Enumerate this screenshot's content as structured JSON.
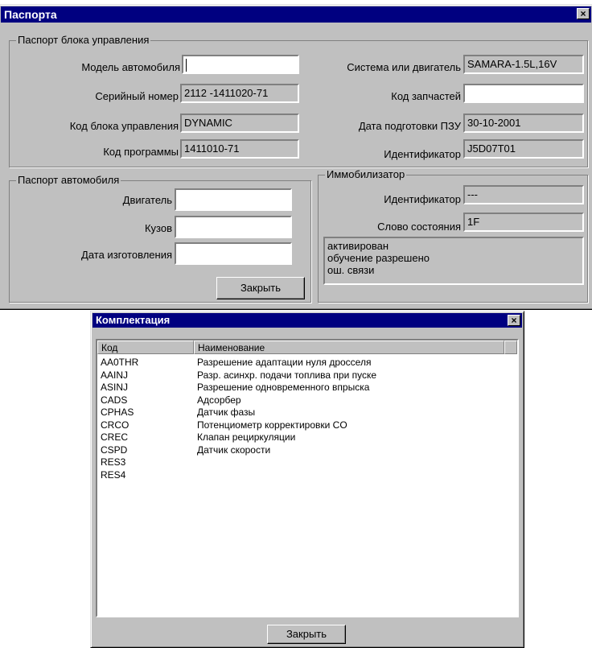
{
  "passport": {
    "title": "Паспорта",
    "close_icon": "×",
    "ecu_group": {
      "title": "Паспорт блока управления",
      "model_label": "Модель автомобиля",
      "model_value": "",
      "serial_label": "Серийный номер",
      "serial_value": "2112 -1411020-71",
      "ecu_code_label": "Код блока управления",
      "ecu_code_value": "DYNAMIC",
      "program_label": "Код программы",
      "program_value": "1411010-71",
      "engine_system_label": "Система или двигатель",
      "engine_system_value": "SAMARA-1.5L,16V",
      "parts_code_label": "Код запчастей",
      "parts_code_value": "",
      "rom_date_label": "Дата подготовки ПЗУ",
      "rom_date_value": "30-10-2001",
      "identifier_label": "Идентификатор",
      "identifier_value": "J5D07T01"
    },
    "car_group": {
      "title": "Паспорт автомобиля",
      "engine_label": "Двигатель",
      "engine_value": "",
      "body_label": "Кузов",
      "body_value": "",
      "mfg_date_label": "Дата изготовления",
      "mfg_date_value": ""
    },
    "immo_group": {
      "title": "Иммобилизатор",
      "identifier_label": "Идентификатор",
      "identifier_value": "---",
      "status_word_label": "Слово состояния",
      "status_word_value": "1F",
      "status_lines": [
        "активирован",
        "обучение разрешено",
        "ош. связи"
      ]
    },
    "close_button": "Закрыть"
  },
  "equipment": {
    "title": "Комплектация",
    "close_icon": "×",
    "columns": [
      "Код",
      "Наименование"
    ],
    "rows": [
      {
        "code": "AA0THR",
        "name": "Разрешение адаптации нуля дросселя"
      },
      {
        "code": "AAINJ",
        "name": "Разр. асинхр. подачи топлива при пуске"
      },
      {
        "code": "ASINJ",
        "name": "Разрешение одновременного впрыска"
      },
      {
        "code": "CADS",
        "name": "Адсорбер"
      },
      {
        "code": "CPHAS",
        "name": "Датчик фазы"
      },
      {
        "code": "CRCO",
        "name": "Потенциометр корректировки CO"
      },
      {
        "code": "CREC",
        "name": "Клапан рециркуляции"
      },
      {
        "code": "CSPD",
        "name": "Датчик скорости"
      },
      {
        "code": "RES3",
        "name": ""
      },
      {
        "code": "RES4",
        "name": ""
      }
    ],
    "close_button": "Закрыть"
  }
}
